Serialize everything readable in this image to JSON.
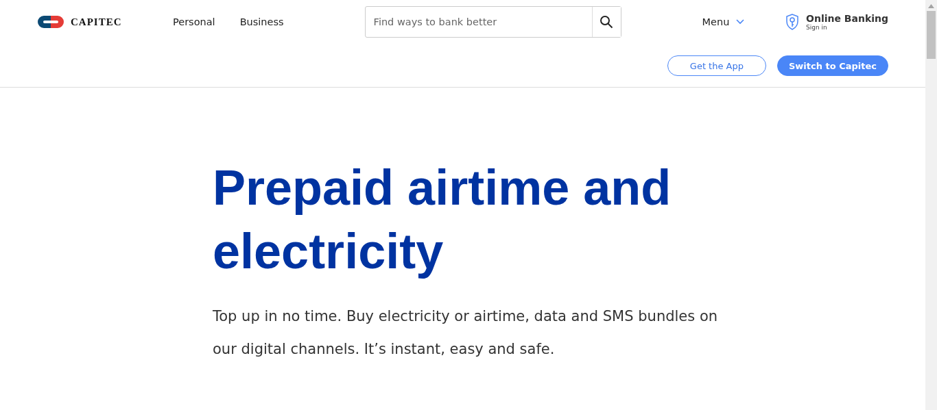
{
  "header": {
    "logo": {
      "name": "CAPITEC"
    },
    "nav": [
      {
        "label": "Personal"
      },
      {
        "label": "Business"
      }
    ],
    "search": {
      "placeholder": "Find ways to bank better"
    },
    "menu": {
      "label": "Menu"
    },
    "online_banking": {
      "title": "Online Banking",
      "subtitle": "Sign in"
    },
    "buttons": [
      {
        "label": "Get the App",
        "kind": "outline"
      },
      {
        "label": "Switch to Capitec",
        "kind": "filled"
      }
    ]
  },
  "hero": {
    "title": "Prepaid airtime and electricity",
    "text": "Top up in no time. Buy electricity or airtime, data and SMS bundles on our digital channels. It’s instant, easy and safe."
  }
}
